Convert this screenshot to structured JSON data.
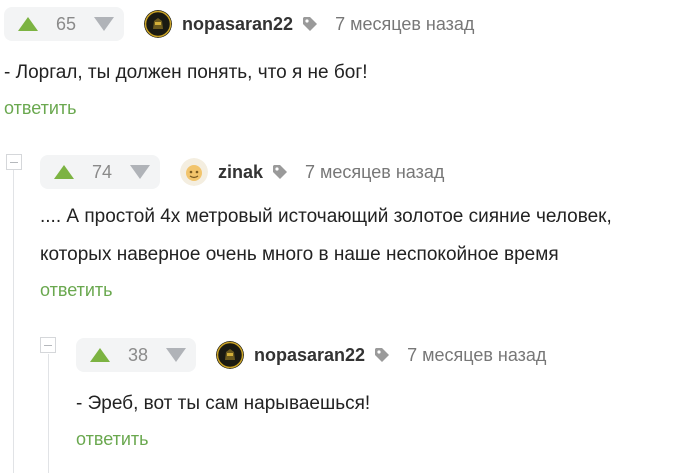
{
  "comments": [
    {
      "rating": "65",
      "author": "nopasaran22",
      "time": "7 месяцев назад",
      "text": "- Лоргал, ты должен понять, что я не бог!",
      "reply": "ответить"
    },
    {
      "rating": "74",
      "author": "zinak",
      "time": "7 месяцев назад",
      "text_line1": ".... А простой 4х метровый источающий золотое сияние человек,",
      "text_line2": "которых наверное очень много в наше неспокойное время",
      "reply": "ответить"
    },
    {
      "rating": "38",
      "author": "nopasaran22",
      "time": "7 месяцев назад",
      "text": "- Эреб, вот ты сам нарываешься!",
      "reply": "ответить"
    }
  ],
  "colors": {
    "upvote": "#7cb342",
    "downvote": "#b0b3b8",
    "reply_link": "#6aa84f",
    "rating_bg": "#f3f4f5"
  },
  "icons": [
    "upvote-icon",
    "downvote-icon",
    "tag-icon",
    "collapse-icon"
  ]
}
